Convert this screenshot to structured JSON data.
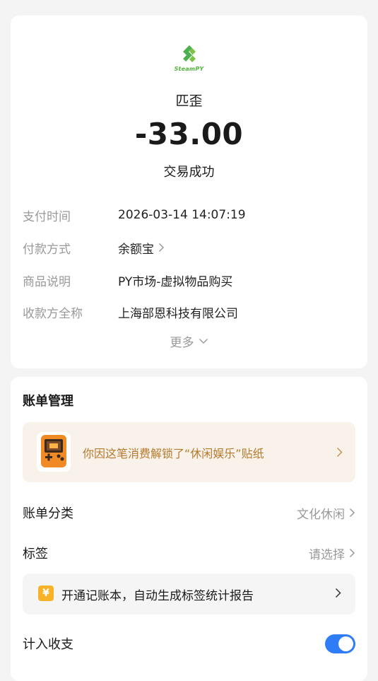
{
  "header": {
    "logo_text": "SteamPY",
    "merchant": "匹歪",
    "amount": "-33.00",
    "status": "交易成功"
  },
  "details": [
    {
      "key": "支付时间",
      "value": "2026-03-14 14:07:19"
    },
    {
      "key": "付款方式",
      "value": "余额宝"
    },
    {
      "key": "商品说明",
      "value": "PY市场-虚拟物品购买"
    },
    {
      "key": "收款方全称",
      "value": "上海部恩科技有限公司"
    }
  ],
  "more_label": "更多",
  "bill": {
    "title": "账单管理",
    "sticker_text": "你因这笔消费解锁了“休闲娱乐”贴纸",
    "category_label": "账单分类",
    "category_value": "文化休闲",
    "tag_label": "标签",
    "tag_value": "请选择",
    "ledger_icon": "¥",
    "ledger_text": "开通记账本，自动生成标签统计报告",
    "count_label": "计入收支",
    "count_enabled": true
  },
  "colors": {
    "accent_blue": "#2f7df6",
    "brand_green": "#52b63a",
    "sticker_text": "#b57a2e"
  }
}
